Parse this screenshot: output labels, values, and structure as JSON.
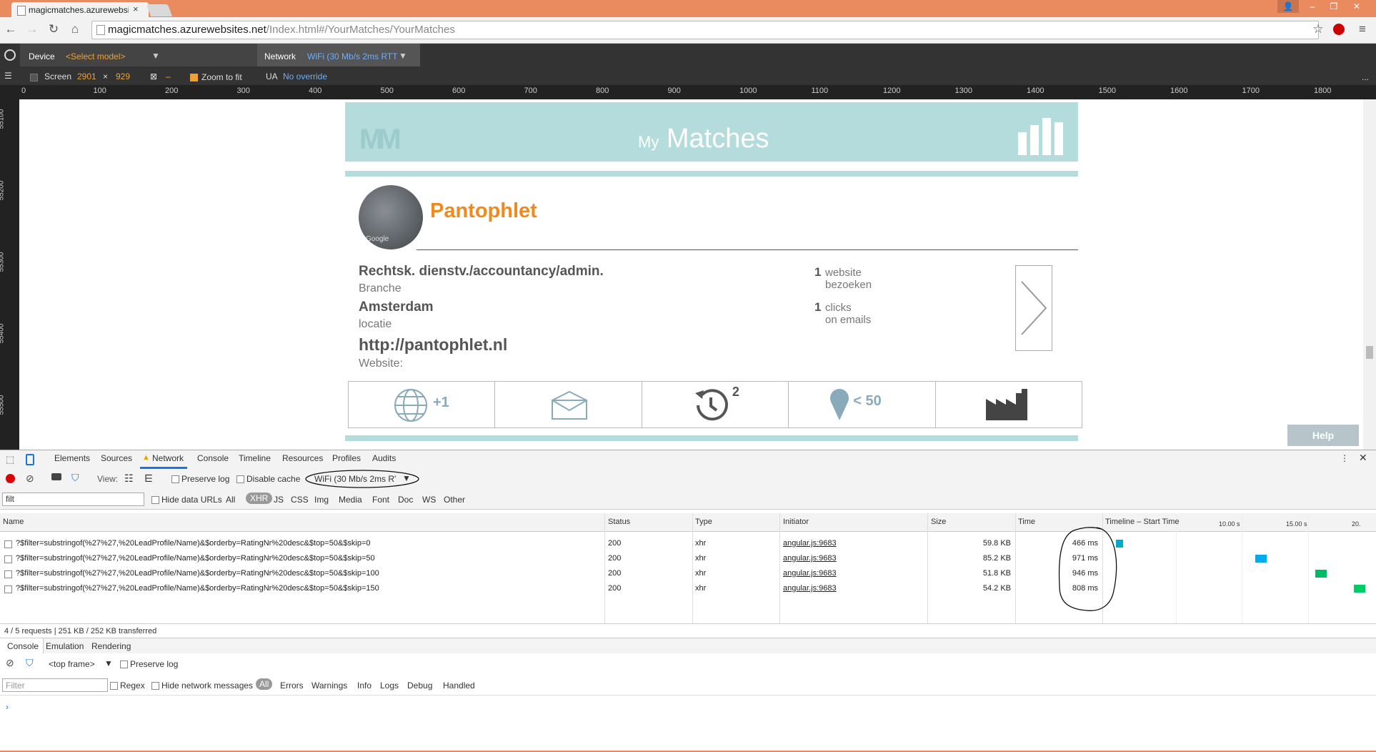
{
  "browser": {
    "tab_title": "magicmatches.azurewebsi",
    "tab_close": "×",
    "url_host": "magicmatches.azurewebsites.net",
    "url_path": "/Index.html#/YourMatches/YourMatches",
    "window_controls": [
      "–",
      "❐",
      "✕"
    ]
  },
  "device_bar": {
    "device_label": "Device",
    "device_model": "<Select model>",
    "network_label": "Network",
    "network_value": "WiFi (30 Mb/s 2ms RTT",
    "screen_label": "Screen",
    "screen_w": "2901",
    "screen_x": "×",
    "screen_h": "929",
    "dash": "–",
    "zoom_label": "Zoom to fit",
    "ua_label": "UA",
    "ua_value": "No override",
    "more": "..."
  },
  "ruler_top": [
    "0",
    "100",
    "200",
    "300",
    "400",
    "500",
    "600",
    "700",
    "800",
    "900",
    "1000",
    "1100",
    "1200",
    "1300",
    "1400",
    "1500",
    "1600",
    "1700",
    "1800"
  ],
  "ruler_left": [
    "55100",
    "55200",
    "55300",
    "55400",
    "55500"
  ],
  "page": {
    "logo": "MM",
    "title_small": "My",
    "title": "Matches",
    "company_name": "Pantophlet",
    "avatar_credit": "Google",
    "branche_value": "Rechtsk. dienstv./accountancy/admin.",
    "branche_label": "Branche",
    "location_value": "Amsterdam",
    "location_label": "locatie",
    "website_value": "http://pantophlet.nl",
    "website_label": "Website:",
    "stat1_num": "1",
    "stat1_l1": "website",
    "stat1_l2": "bezoeken",
    "stat2_num": "1",
    "stat2_l1": "clicks",
    "stat2_l2": "on emails",
    "icon_globe_badge": "+1",
    "icon_history_badge": "2",
    "icon_pin_badge": "< 50",
    "help": "Help"
  },
  "devtools": {
    "tabs": [
      "Elements",
      "Sources",
      "Network",
      "Console",
      "Timeline",
      "Resources",
      "Profiles",
      "Audits"
    ],
    "view_label": "View:",
    "preserve_log": "Preserve log",
    "disable_cache": "Disable cache",
    "throttle": "WiFi (30 Mb/s 2ms R'",
    "filter_value": "filt",
    "hide_data_urls": "Hide data URLs",
    "type_filters": [
      "All",
      "XHR",
      "JS",
      "CSS",
      "Img",
      "Media",
      "Font",
      "Doc",
      "WS",
      "Other"
    ],
    "columns": {
      "name": "Name",
      "status": "Status",
      "type": "Type",
      "initiator": "Initiator",
      "size": "Size",
      "time": "Time",
      "timeline": "Timeline – Start Time",
      "t1": "10.00 s",
      "t2": "15.00 s",
      "t3": "20."
    },
    "rows": [
      {
        "name": "?$filter=substringof(%27%27,%20LeadProfile/Name)&$orderby=RatingNr%20desc&$top=50&$skip=0",
        "status": "200",
        "type": "xhr",
        "initiator": "angular.js:9683",
        "size": "59.8 KB",
        "time": "466 ms",
        "bar_start": 0.03,
        "bar_color": "#00aacc"
      },
      {
        "name": "?$filter=substringof(%27%27,%20LeadProfile/Name)&$orderby=RatingNr%20desc&$top=50&$skip=50",
        "status": "200",
        "type": "xhr",
        "initiator": "angular.js:9683",
        "size": "85.2 KB",
        "time": "971 ms",
        "bar_start": 0.57,
        "bar_color": "#00aaee"
      },
      {
        "name": "?$filter=substringof(%27%27,%20LeadProfile/Name)&$orderby=RatingNr%20desc&$top=50&$skip=100",
        "status": "200",
        "type": "xhr",
        "initiator": "angular.js:9683",
        "size": "51.8 KB",
        "time": "946 ms",
        "bar_start": 0.8,
        "bar_color": "#00bb66"
      },
      {
        "name": "?$filter=substringof(%27%27,%20LeadProfile/Name)&$orderby=RatingNr%20desc&$top=50&$skip=150",
        "status": "200",
        "type": "xhr",
        "initiator": "angular.js:9683",
        "size": "54.2 KB",
        "time": "808 ms",
        "bar_start": 0.95,
        "bar_color": "#00cc66"
      }
    ],
    "summary": "4 / 5 requests  |  251 KB / 252 KB transferred",
    "drawer_tabs": [
      "Console",
      "Emulation",
      "Rendering"
    ],
    "frame": "<top frame>",
    "console_preserve": "Preserve log",
    "console_filter_placeholder": "Filter",
    "regex": "Regex",
    "hide_network": "Hide network messages",
    "levels": [
      "All",
      "Errors",
      "Warnings",
      "Info",
      "Logs",
      "Debug",
      "Handled"
    ],
    "prompt": "›"
  }
}
